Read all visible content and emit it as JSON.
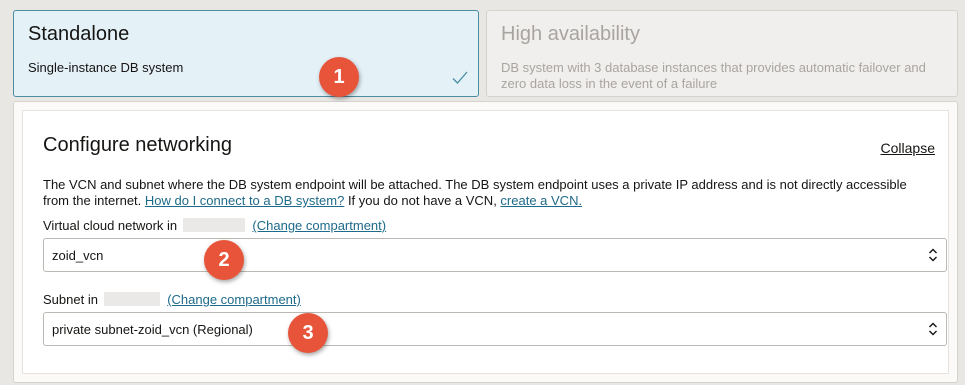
{
  "deployment": {
    "standalone": {
      "title": "Standalone",
      "description": "Single-instance DB system",
      "selected": true
    },
    "high_availability": {
      "title": "High availability",
      "description": "DB system with 3 database instances that provides automatic failover and zero data loss in the event of a failure",
      "selected": false
    }
  },
  "networking": {
    "title": "Configure networking",
    "collapse_label": "Collapse",
    "description_text": "The VCN and subnet where the DB system endpoint will be attached. The DB system endpoint uses a private IP address and is not directly accessible from the internet. ",
    "connect_link": "How do I connect to a DB system?",
    "description_mid": " If you do not have a VCN, ",
    "create_vcn_link": "create a VCN.",
    "vcn": {
      "label": "Virtual cloud network in",
      "change_label": "(Change compartment)",
      "value": "zoid_vcn"
    },
    "subnet": {
      "label": "Subnet in",
      "change_label": "(Change compartment)",
      "value": "private subnet-zoid_vcn (Regional)"
    }
  },
  "callouts": [
    "1",
    "2",
    "3"
  ],
  "colors": {
    "accent": "#1e6a8a",
    "callout": "#e8543a",
    "selected_bg": "#e4f1f7"
  }
}
